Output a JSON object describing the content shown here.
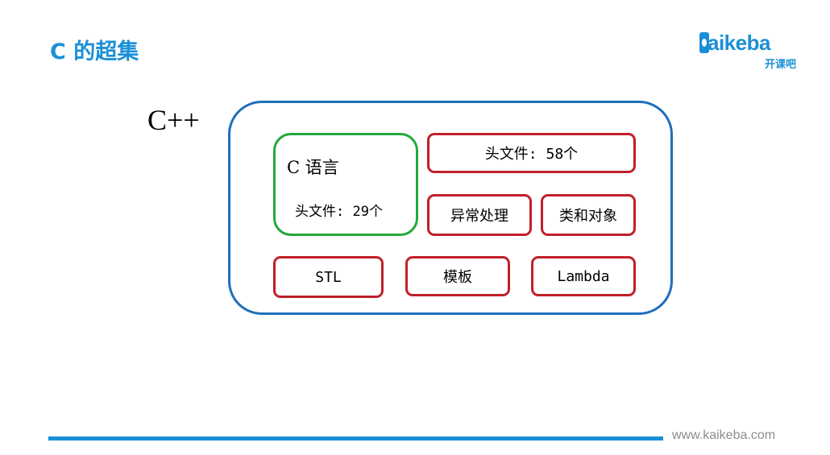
{
  "slide": {
    "title": "C 的超集",
    "cpp_label": "C++",
    "c_language": {
      "title": "C 语言",
      "headers": "头文件: 29个"
    },
    "cpp_boxes": {
      "headers": "头文件: 58个",
      "exceptions": "异常处理",
      "classes": "类和对象",
      "stl": "STL",
      "templates": "模板",
      "lambda": "Lambda"
    }
  },
  "logo": {
    "word": "aikeba",
    "sub": "开课吧"
  },
  "footer": {
    "url": "www.kaikeba.com"
  },
  "colors": {
    "accent": "#1b8fd6",
    "outer_border": "#1f6fba",
    "c_border": "#22a83c",
    "box_border": "#c0202a"
  }
}
